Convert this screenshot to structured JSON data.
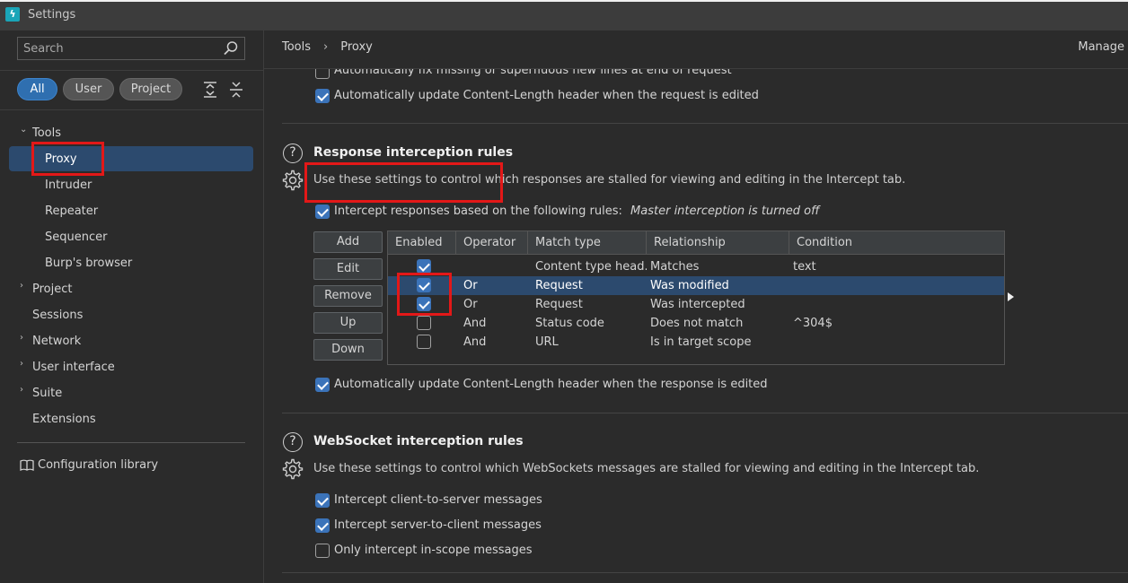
{
  "window": {
    "title": "Settings",
    "app_icon": "burp-icon"
  },
  "sidebar": {
    "search_placeholder": "Search",
    "filters": [
      "All",
      "User",
      "Project"
    ],
    "tree": {
      "tools": "Tools",
      "proxy": "Proxy",
      "intruder": "Intruder",
      "repeater": "Repeater",
      "sequencer": "Sequencer",
      "burps_browser": "Burp's browser",
      "project": "Project",
      "sessions": "Sessions",
      "network": "Network",
      "user_interface": "User interface",
      "suite": "Suite",
      "extensions": "Extensions"
    },
    "config_library": "Configuration library"
  },
  "header": {
    "breadcrumb": [
      "Tools",
      "Proxy"
    ],
    "manage": "Manage"
  },
  "request_tail": {
    "fix_newlines": "Automatically fix missing or superfluous new lines at end of request",
    "update_length": "Automatically update Content-Length header when the request is edited"
  },
  "response_rules": {
    "title": "Response interception rules",
    "description": "Use these settings to control which responses are stalled for viewing and editing in the Intercept tab.",
    "intercept_label": "Intercept responses based on the following rules:",
    "master_note": "Master interception is turned off",
    "buttons": [
      "Add",
      "Edit",
      "Remove",
      "Up",
      "Down"
    ],
    "columns": [
      "Enabled",
      "Operator",
      "Match type",
      "Relationship",
      "Condition"
    ],
    "rows": [
      {
        "enabled": true,
        "operator": "",
        "match_type": "Content type head...",
        "relationship": "Matches",
        "condition": "text"
      },
      {
        "enabled": true,
        "operator": "Or",
        "match_type": "Request",
        "relationship": "Was modified",
        "condition": ""
      },
      {
        "enabled": true,
        "operator": "Or",
        "match_type": "Request",
        "relationship": "Was intercepted",
        "condition": ""
      },
      {
        "enabled": false,
        "operator": "And",
        "match_type": "Status code",
        "relationship": "Does not match",
        "condition": "^304$"
      },
      {
        "enabled": false,
        "operator": "And",
        "match_type": "URL",
        "relationship": "Is in target scope",
        "condition": ""
      }
    ],
    "update_length": "Automatically update Content-Length header when the response is edited"
  },
  "websocket_rules": {
    "title": "WebSocket interception rules",
    "description": "Use these settings to control which WebSockets messages are stalled for viewing and editing in the Intercept tab.",
    "client_to_server": "Intercept client-to-server messages",
    "server_to_client": "Intercept server-to-client messages",
    "in_scope_only": "Only intercept in-scope messages"
  },
  "colors": {
    "accent": "#3b73b9",
    "selection": "#2c4a6e",
    "highlight_box": "#e31818"
  }
}
